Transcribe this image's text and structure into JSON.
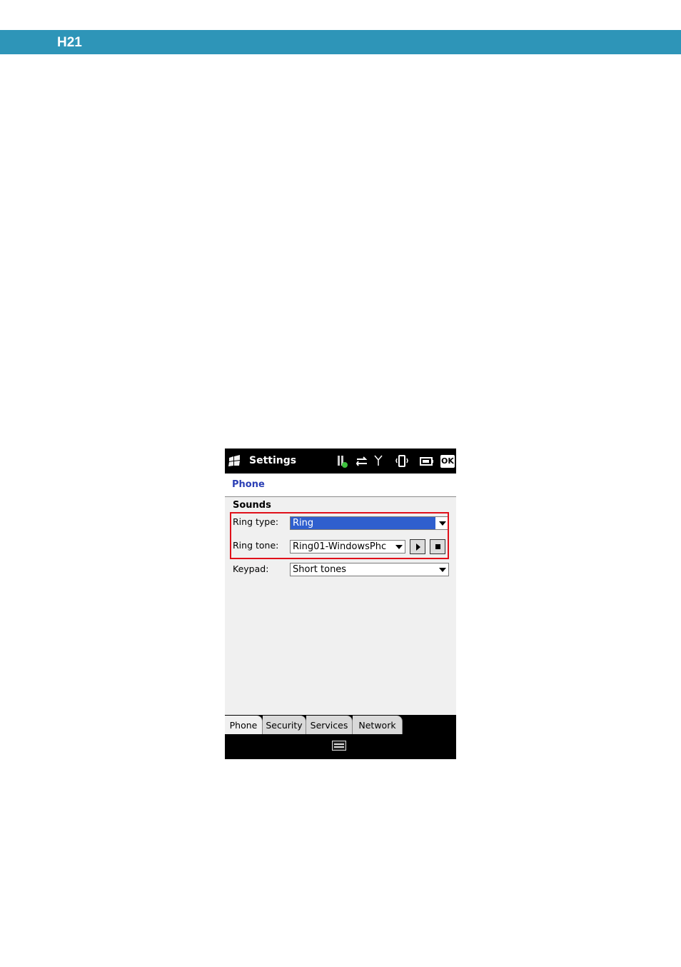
{
  "doc_header": {
    "label": "H21",
    "color": "#2e95b8"
  },
  "window": {
    "title": "Settings",
    "ok_label": "OK",
    "status_icons": [
      "signal-green-icon",
      "data-sync-icon",
      "antenna-icon",
      "vibrate-icon",
      "battery-icon"
    ]
  },
  "page": {
    "header": "Phone",
    "section": "Sounds",
    "fields": [
      {
        "label": "Ring type:",
        "value": "Ring",
        "selected": true
      },
      {
        "label": "Ring tone:",
        "value": "Ring01-WindowsPhc"
      },
      {
        "label": "Keypad:",
        "value": "Short tones"
      }
    ],
    "highlight_color": "#e0101a"
  },
  "tabs": [
    {
      "label": "Phone",
      "active": true
    },
    {
      "label": "Security"
    },
    {
      "label": "Services"
    },
    {
      "label": "Network"
    }
  ],
  "softbar": {
    "icon": "keyboard-icon"
  }
}
